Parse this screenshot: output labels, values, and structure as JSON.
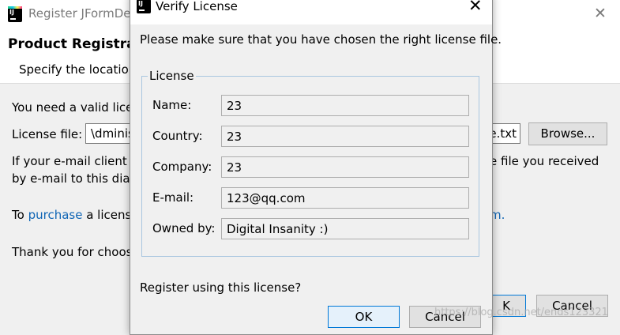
{
  "background_window": {
    "title": "Register JFormDe",
    "heading": "Product Registrat",
    "subheading": "Specify the location",
    "need_valid": "You need a valid lice",
    "license_file_label": "License file:",
    "license_file_value_left": "\\dminis",
    "license_file_value_right": "e.txt",
    "browse_label": "Browse...",
    "email_line1_left": "If your e-mail client s",
    "email_line1_right": "e file you received",
    "email_line2": "by e-mail to this dial",
    "to_prefix": "To",
    "purchase_link": "purchase",
    "license_text": "a licens",
    "tail_link": "m.",
    "thank_you": "Thank you for choos",
    "ok_label": "K",
    "cancel_label": "Cancel"
  },
  "dialog": {
    "title": "Verify License",
    "message": "Please make sure that you have chosen the right license file.",
    "group_label": "License",
    "fields": [
      {
        "label": "Name:",
        "value": "23"
      },
      {
        "label": "Country:",
        "value": "23"
      },
      {
        "label": "Company:",
        "value": "23"
      },
      {
        "label": "E-mail:",
        "value": "123@qq.com"
      },
      {
        "label": "Owned by:",
        "value": "Digital Insanity :)"
      }
    ],
    "register_question": "Register using this license?",
    "ok_label": "OK",
    "cancel_label": "Cancel"
  },
  "watermark": "https://blog.csdn.net/ends123321",
  "icons": {
    "app": "intellij-app-icon",
    "close": "close-icon"
  }
}
